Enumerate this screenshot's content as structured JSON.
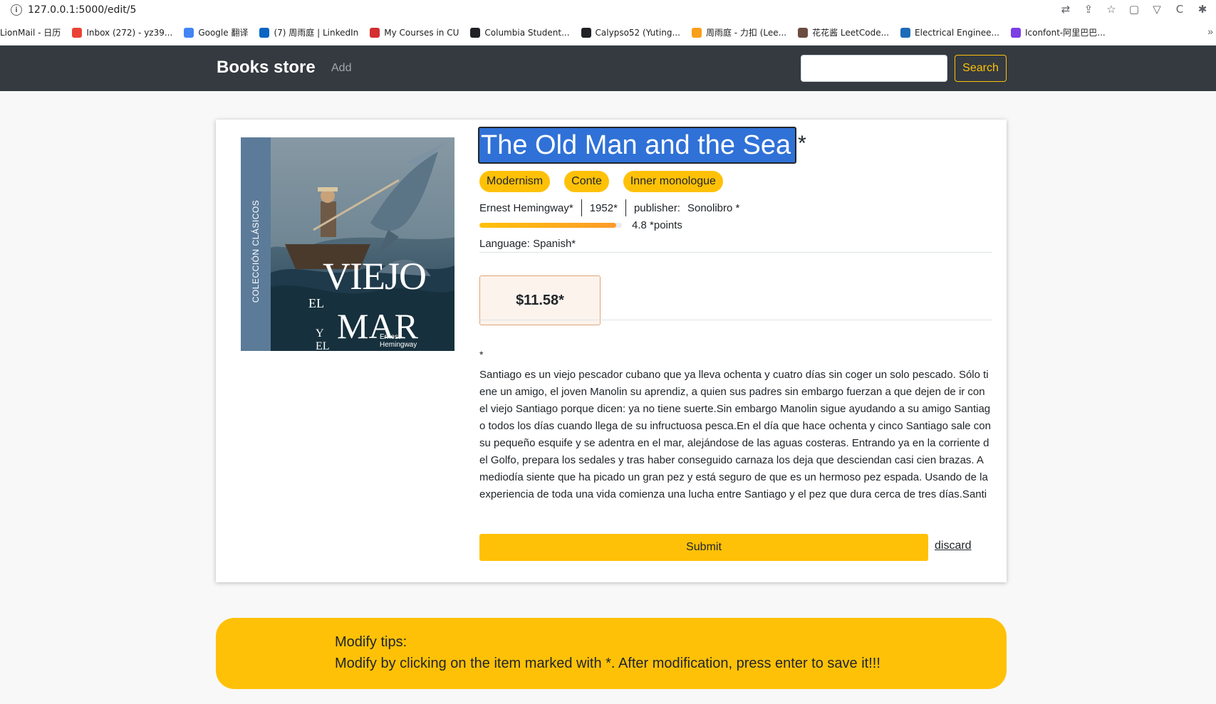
{
  "browser": {
    "url": "127.0.0.1:5000/edit/5",
    "bookmarks": [
      {
        "label": "LionMail - 日历",
        "icon": "none-icon",
        "color": "#ffffff"
      },
      {
        "label": "Inbox (272) - yz39...",
        "icon": "gmail-icon",
        "color": "#ea4335"
      },
      {
        "label": "Google 翻译",
        "icon": "google-translate-icon",
        "color": "#4285f4"
      },
      {
        "label": "(7) 周雨庭 | LinkedIn",
        "icon": "linkedin-icon",
        "color": "#0a66c2"
      },
      {
        "label": "My Courses in CU",
        "icon": "courseworks-icon",
        "color": "#d32f2f"
      },
      {
        "label": "Columbia Student...",
        "icon": "columbia-icon",
        "color": "#202124"
      },
      {
        "label": "Calypso52 (Yuting...",
        "icon": "github-icon",
        "color": "#202124"
      },
      {
        "label": "周雨庭 - 力扣 (Lee...",
        "icon": "leetcode-cn-icon",
        "color": "#f89f1b"
      },
      {
        "label": "花花酱 LeetCode...",
        "icon": "huahua-icon",
        "color": "#6d4c41"
      },
      {
        "label": "Electrical Enginee...",
        "icon": "columbia-crown-icon",
        "color": "#1e6bb8"
      },
      {
        "label": "Iconfont-阿里巴巴...",
        "icon": "iconfont-icon",
        "color": "#7b3fe4"
      }
    ]
  },
  "navbar": {
    "brand": "Books store",
    "add_label": "Add",
    "search_value": "",
    "search_label": "Search"
  },
  "book": {
    "title": "The Old Man and the Sea",
    "title_mark": "*",
    "tags": [
      "Modernism",
      "Conte",
      "Inner monologue"
    ],
    "author": "Ernest Hemingway*",
    "year": "1952*",
    "publisher_label": "publisher:",
    "publisher": "Sonolibro *",
    "rating": 4.8,
    "rating_max": 5,
    "rating_text": "4.8 *points",
    "language": "Language: Spanish*",
    "price": "$11.58*",
    "description_mark": "*",
    "description": "Santiago es un viejo pescador cubano que ya lleva ochenta y cuatro días sin coger un solo pescado. Sólo tiene un amigo, el joven Manolin su aprendiz, a quien sus padres sin embargo fuerzan a que dejen de ir con el viejo Santiago porque dicen: ya no tiene suerte.Sin embargo Manolin sigue ayudando a su amigo Santiago todos los días cuando llega de su infructuosa pesca.En el día que hace ochenta y cinco Santiago sale con su pequeño esquife y se adentra en el mar, alejándose de las aguas costeras. Entrando ya en la corriente del Golfo, prepara los sedales y tras haber conseguido carnaza los deja que desciendan casi cien brazas. A mediodía siente que ha picado un gran pez y está seguro de que es un hermoso pez espada. Usando de la experiencia de toda una vida comienza una lucha entre Santiago y el pez que dura cerca de tres días.Santiago es la personificación de la lucha contra el fracaso. Nunca se..."
  },
  "cover": {
    "spine_text": "COLECCIÓN CLÁSICOS",
    "el": "EL",
    "viejo": "VIEJO",
    "y_el": "Y EL",
    "mar": "MAR",
    "author_line1": "Ernest",
    "author_line2": "Hemingway"
  },
  "actions": {
    "submit_label": "Submit",
    "discard_label": "discard"
  },
  "tips": {
    "heading": "Modify tips:",
    "text": "Modify by clicking on the item marked with *. After modification, press enter to save it!!!"
  },
  "colors": {
    "navbar_bg": "#343a40",
    "accent": "#ffc107",
    "selection": "#2f71d7",
    "price_bg": "#fcf3ec"
  }
}
